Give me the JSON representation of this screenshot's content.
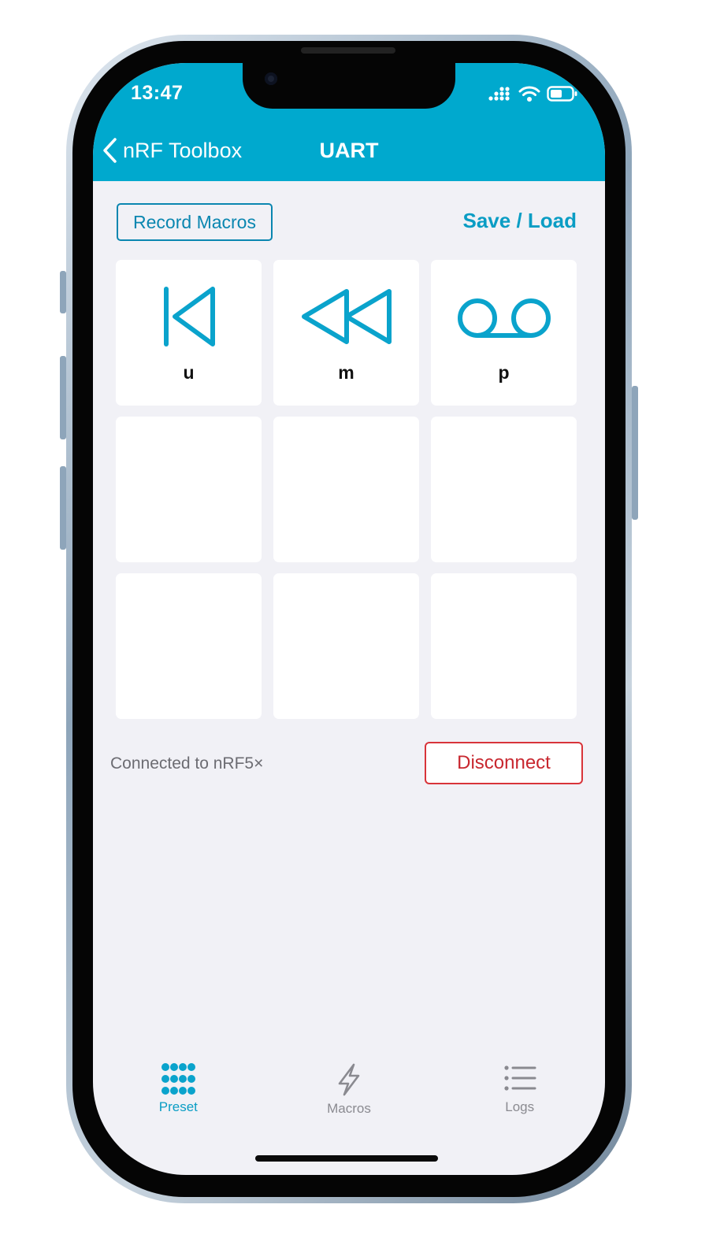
{
  "status_bar": {
    "time": "13:47"
  },
  "nav": {
    "back_label": "nRF Toolbox",
    "title": "UART"
  },
  "toolbar": {
    "record_label": "Record Macros",
    "save_load_label": "Save / Load"
  },
  "grid": {
    "cells": [
      {
        "icon": "skip-back-icon",
        "label": "u"
      },
      {
        "icon": "rewind-icon",
        "label": "m"
      },
      {
        "icon": "voicemail-icon",
        "label": "p"
      },
      {
        "icon": "",
        "label": ""
      },
      {
        "icon": "",
        "label": ""
      },
      {
        "icon": "",
        "label": ""
      },
      {
        "icon": "",
        "label": ""
      },
      {
        "icon": "",
        "label": ""
      },
      {
        "icon": "",
        "label": ""
      }
    ]
  },
  "connection": {
    "status_text": "Connected to nRF5×",
    "disconnect_label": "Disconnect"
  },
  "tabs": [
    {
      "label": "Preset",
      "icon": "grid-dots-icon",
      "active": true
    },
    {
      "label": "Macros",
      "icon": "lightning-icon",
      "active": false
    },
    {
      "label": "Logs",
      "icon": "list-icon",
      "active": false
    }
  ],
  "colors": {
    "accent": "#00a9ce",
    "icon_blue": "#0aa3cc",
    "danger": "#d8343a",
    "background": "#f1f1f6"
  }
}
